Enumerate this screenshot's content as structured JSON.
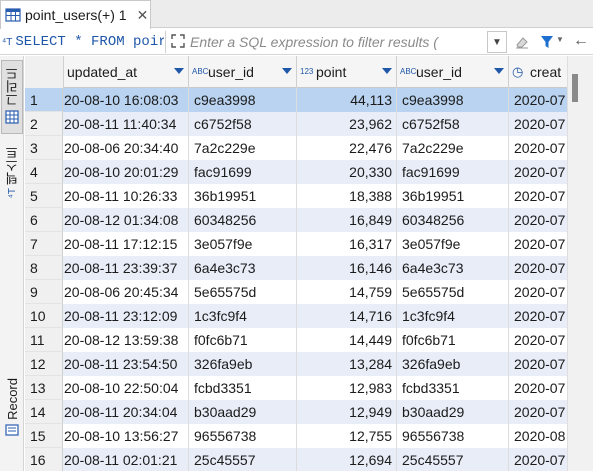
{
  "tab": {
    "title": "point_users(+) 1",
    "close_label": "✕",
    "icon": "table-icon"
  },
  "filterbar": {
    "sql_text": "SELECT * FROM poir",
    "filter_placeholder": "Enter a SQL expression to filter results (",
    "dropdown_glyph": "▼",
    "funnel_dropdown_glyph": "▼",
    "back_glyph": "←"
  },
  "leftbar": {
    "grid_label": "그리드",
    "text_label": "텍스트",
    "record_label": "Record"
  },
  "columns": [
    {
      "name": "updated_at",
      "type": "datetime",
      "type_icon": "",
      "sortable": true
    },
    {
      "name": "user_id",
      "type": "string",
      "type_icon": "ABC",
      "sortable": true
    },
    {
      "name": "point",
      "type": "number",
      "type_icon": "123",
      "sortable": true
    },
    {
      "name": "user_id",
      "type": "string",
      "type_icon": "ABC",
      "sortable": true
    },
    {
      "name": "creat",
      "type": "datetime",
      "type_icon": "◷",
      "sortable": false
    }
  ],
  "rows": [
    {
      "n": "1",
      "updated_at": "20-08-10 16:08:03",
      "user_id": "c9ea3998",
      "point": "44,113",
      "user_id2": "c9ea3998",
      "created": "2020-07"
    },
    {
      "n": "2",
      "updated_at": "20-08-11 11:40:34",
      "user_id": "c6752f58",
      "point": "23,962",
      "user_id2": "c6752f58",
      "created": "2020-07"
    },
    {
      "n": "3",
      "updated_at": "20-08-06 20:34:40",
      "user_id": "7a2c229e",
      "point": "22,476",
      "user_id2": "7a2c229e",
      "created": "2020-07"
    },
    {
      "n": "4",
      "updated_at": "20-08-10 20:01:29",
      "user_id": "fac91699",
      "point": "20,330",
      "user_id2": "fac91699",
      "created": "2020-07"
    },
    {
      "n": "5",
      "updated_at": "20-08-11 10:26:33",
      "user_id": "36b19951",
      "point": "18,388",
      "user_id2": "36b19951",
      "created": "2020-07"
    },
    {
      "n": "6",
      "updated_at": "20-08-12 01:34:08",
      "user_id": "60348256",
      "point": "16,849",
      "user_id2": "60348256",
      "created": "2020-07"
    },
    {
      "n": "7",
      "updated_at": "20-08-11 17:12:15",
      "user_id": "3e057f9e",
      "point": "16,317",
      "user_id2": "3e057f9e",
      "created": "2020-07"
    },
    {
      "n": "8",
      "updated_at": "20-08-11 23:39:37",
      "user_id": "6a4e3c73",
      "point": "16,146",
      "user_id2": "6a4e3c73",
      "created": "2020-07"
    },
    {
      "n": "9",
      "updated_at": "20-08-06 20:45:34",
      "user_id": "5e65575d",
      "point": "14,759",
      "user_id2": "5e65575d",
      "created": "2020-07"
    },
    {
      "n": "10",
      "updated_at": "20-08-11 23:12:09",
      "user_id": "1c3fc9f4",
      "point": "14,716",
      "user_id2": "1c3fc9f4",
      "created": "2020-07"
    },
    {
      "n": "11",
      "updated_at": "20-08-12 13:59:38",
      "user_id": "f0fc6b71",
      "point": "14,449",
      "user_id2": "f0fc6b71",
      "created": "2020-07"
    },
    {
      "n": "12",
      "updated_at": "20-08-11 23:54:50",
      "user_id": "326fa9eb",
      "point": "13,284",
      "user_id2": "326fa9eb",
      "created": "2020-07"
    },
    {
      "n": "13",
      "updated_at": "20-08-10 22:50:04",
      "user_id": "fcbd3351",
      "point": "12,983",
      "user_id2": "fcbd3351",
      "created": "2020-07"
    },
    {
      "n": "14",
      "updated_at": "20-08-11 20:34:04",
      "user_id": "b30aad29",
      "point": "12,949",
      "user_id2": "b30aad29",
      "created": "2020-07"
    },
    {
      "n": "15",
      "updated_at": "20-08-10 13:56:27",
      "user_id": "96556738",
      "point": "12,755",
      "user_id2": "96556738",
      "created": "2020-08"
    },
    {
      "n": "16",
      "updated_at": "20-08-11 02:01:21",
      "user_id": "25c45557",
      "point": "12,694",
      "user_id2": "25c45557",
      "created": "2020-07"
    }
  ],
  "selected_row": 0,
  "colors": {
    "accent": "#1f57a8",
    "selected_row": "#b9d3f0",
    "alt_row": "#e8edf7"
  }
}
